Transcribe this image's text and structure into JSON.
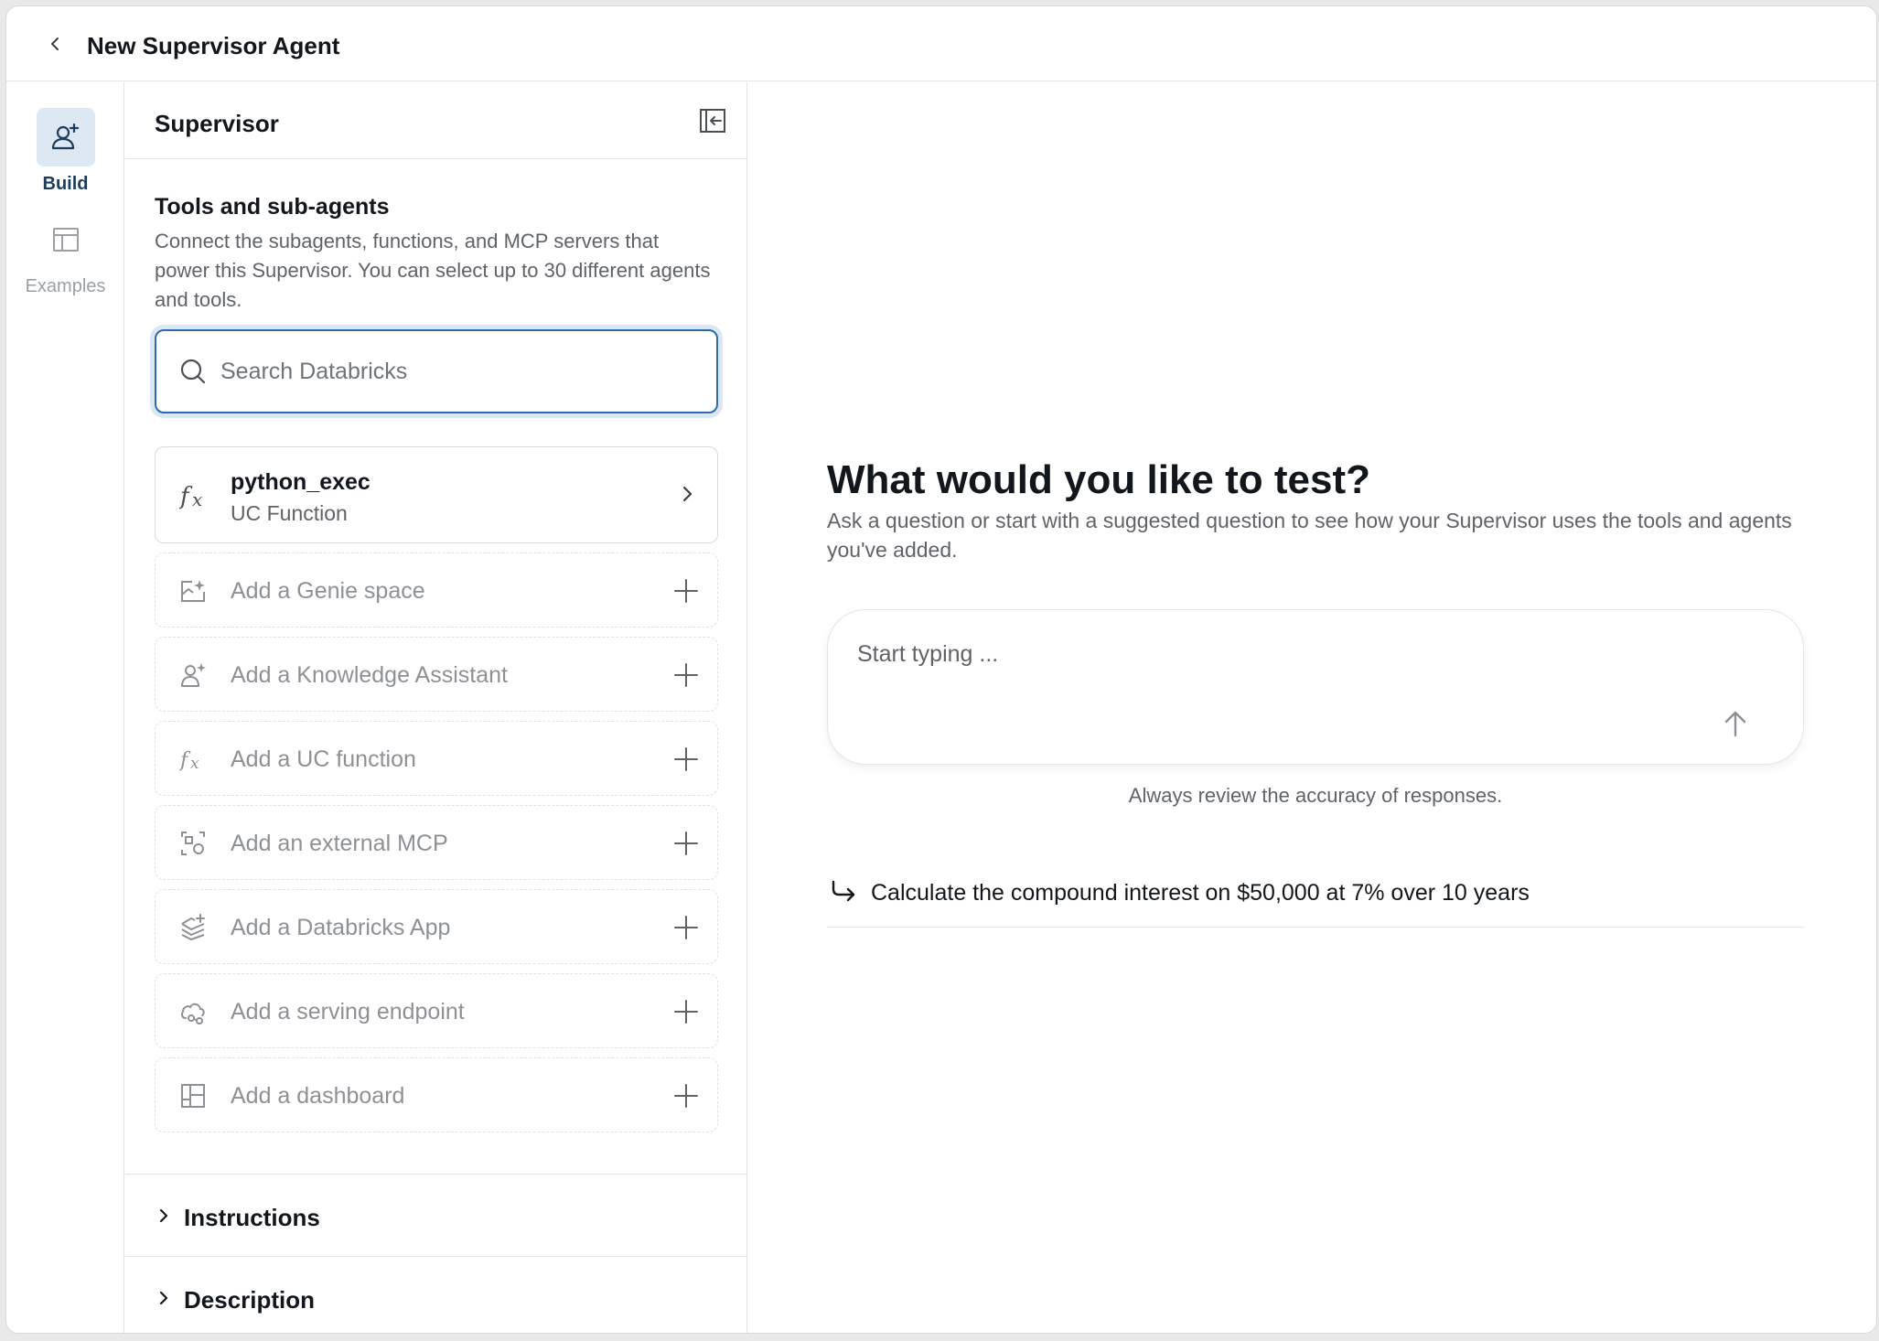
{
  "header": {
    "title": "New Supervisor Agent"
  },
  "rail": {
    "items": [
      {
        "label": "Build",
        "icon": "user-plus-icon",
        "active": true
      },
      {
        "label": "Examples",
        "icon": "table-icon",
        "active": false
      }
    ]
  },
  "panel": {
    "title": "Supervisor",
    "section_title": "Tools and sub-agents",
    "section_desc": "Connect the subagents, functions, and MCP servers that power this Supervisor. You can select up to 30 different agents and tools.",
    "search_placeholder": "Search Databricks",
    "tool": {
      "name": "python_exec",
      "type": "UC Function",
      "icon": "function-icon"
    },
    "add_items": [
      {
        "label": "Add a Genie space",
        "icon": "genie-icon"
      },
      {
        "label": "Add a Knowledge Assistant",
        "icon": "knowledge-assistant-icon"
      },
      {
        "label": "Add a UC function",
        "icon": "function-icon"
      },
      {
        "label": "Add an external MCP",
        "icon": "mcp-icon"
      },
      {
        "label": "Add a Databricks App",
        "icon": "app-icon"
      },
      {
        "label": "Add a serving endpoint",
        "icon": "serving-endpoint-icon"
      },
      {
        "label": "Add a dashboard",
        "icon": "dashboard-icon"
      }
    ],
    "instructions_label": "Instructions",
    "description_label": "Description"
  },
  "main": {
    "title": "What would you like to test?",
    "subtitle": "Ask a question or start with a suggested question to see how your Supervisor uses the tools and agents you've added.",
    "input_placeholder": "Start typing ...",
    "disclaimer": "Always review the accuracy of responses.",
    "suggestion": "Calculate the compound interest on $50,000 at 7% over 10 years"
  },
  "colors": {
    "accent": "#2c6bae",
    "active_rail_bg": "#dde8f3",
    "text_primary": "#11171c",
    "text_secondary": "#5f6368",
    "border": "#e3e5e8"
  }
}
